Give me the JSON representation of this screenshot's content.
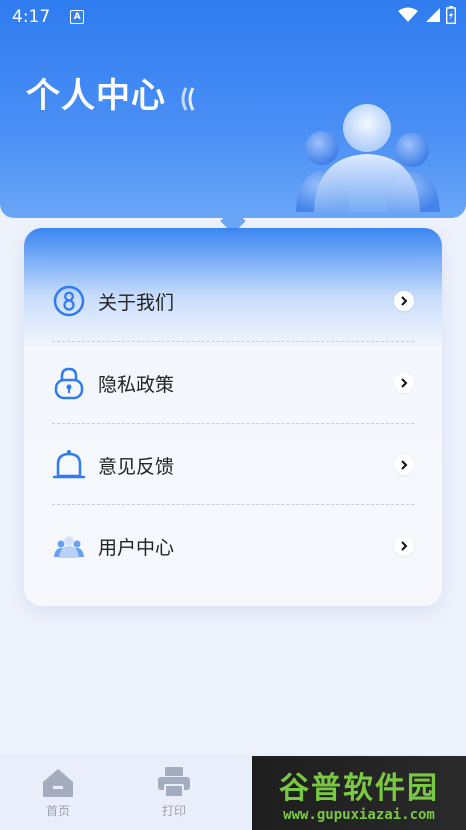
{
  "status_bar": {
    "time": "4:17",
    "notification_icon_text": "A",
    "icons": [
      "wifi-icon",
      "signal-icon",
      "battery-icon"
    ]
  },
  "header": {
    "title": "个人中心",
    "accent_color": "#2f7cf0"
  },
  "menu": {
    "items": [
      {
        "label": "关于我们",
        "icon": "about-icon"
      },
      {
        "label": "隐私政策",
        "icon": "lock-icon"
      },
      {
        "label": "意见反馈",
        "icon": "bell-icon"
      },
      {
        "label": "用户中心",
        "icon": "users-icon"
      }
    ]
  },
  "bottom_nav": {
    "items": [
      {
        "label": "首页",
        "icon": "home-icon"
      },
      {
        "label": "打印",
        "icon": "printer-icon"
      }
    ]
  },
  "watermark": {
    "brand": "谷普软件园",
    "url": "www.gupuxiazai.com"
  }
}
